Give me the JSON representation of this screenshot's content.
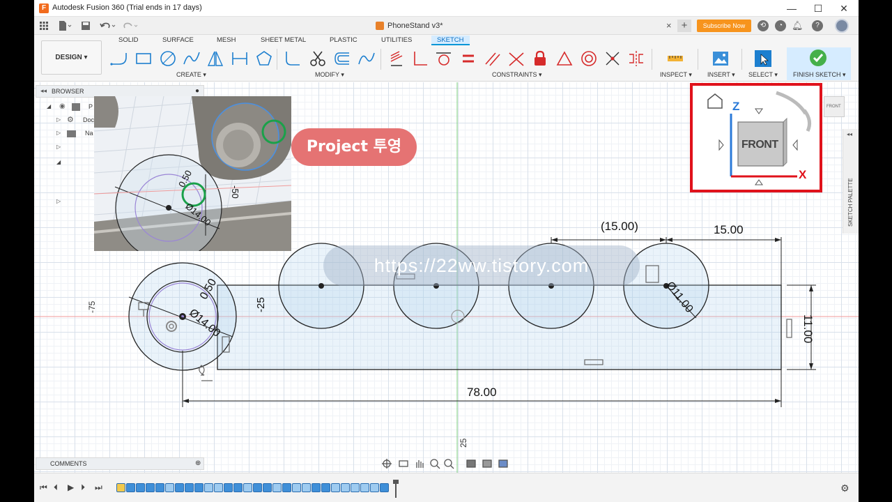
{
  "window": {
    "title": "Autodesk Fusion 360 (Trial ends in 17 days)",
    "minimize": "—",
    "maximize": "☐",
    "close": "✕"
  },
  "tabbar": {
    "document_title": "PhoneStand v3*",
    "close": "×",
    "add": "+",
    "subscribe": "Subscribe Now",
    "help": "?"
  },
  "toolbar": {
    "design_label": "DESIGN ▾",
    "workspace_tabs": [
      "SOLID",
      "SURFACE",
      "MESH",
      "SHEET METAL",
      "PLASTIC",
      "UTILITIES",
      "SKETCH"
    ],
    "active_tab": "SKETCH",
    "groups": {
      "create": "CREATE ▾",
      "modify": "MODIFY ▾",
      "constraints": "CONSTRAINTS ▾",
      "inspect": "INSPECT ▾",
      "insert": "INSERT ▾",
      "select": "SELECT ▾",
      "finish": "FINISH SKETCH ▾"
    }
  },
  "browser": {
    "label": "BROWSER",
    "rows": [
      "P",
      "Doc",
      "Na"
    ]
  },
  "comments": {
    "label": "COMMENTS"
  },
  "callout": {
    "text": "Project 투영"
  },
  "watermark": {
    "text": "https://22ww.tistory.com"
  },
  "viewcube": {
    "face": "FRONT",
    "axis_z": "Z",
    "axis_x": "X",
    "mini_face": "FRONT"
  },
  "palette": {
    "label": "SKETCH PALETTE"
  },
  "sketch": {
    "dim_overall_width": "78.00",
    "dim_height": "11.00",
    "dim_spacing": "15.00",
    "dim_spacing_ref": "(15.00)",
    "dim_circle": "Ø11.00",
    "dim_big_circle": "Ø14.00",
    "dim_small": "0.50",
    "dim_offset": "-25",
    "dim_side": "-75",
    "dim_bottom": "25"
  },
  "inset": {
    "dim_circle": "Ø14.00",
    "dim_small": "0.50",
    "dim_offset": "-50"
  },
  "colors": {
    "accent": "#0696d7",
    "subscribe": "#f7941d",
    "highlight_box": "#e0121b",
    "callout": "#e57373",
    "marker_green": "#1aa14a",
    "constraint_red": "#d62b2b"
  }
}
